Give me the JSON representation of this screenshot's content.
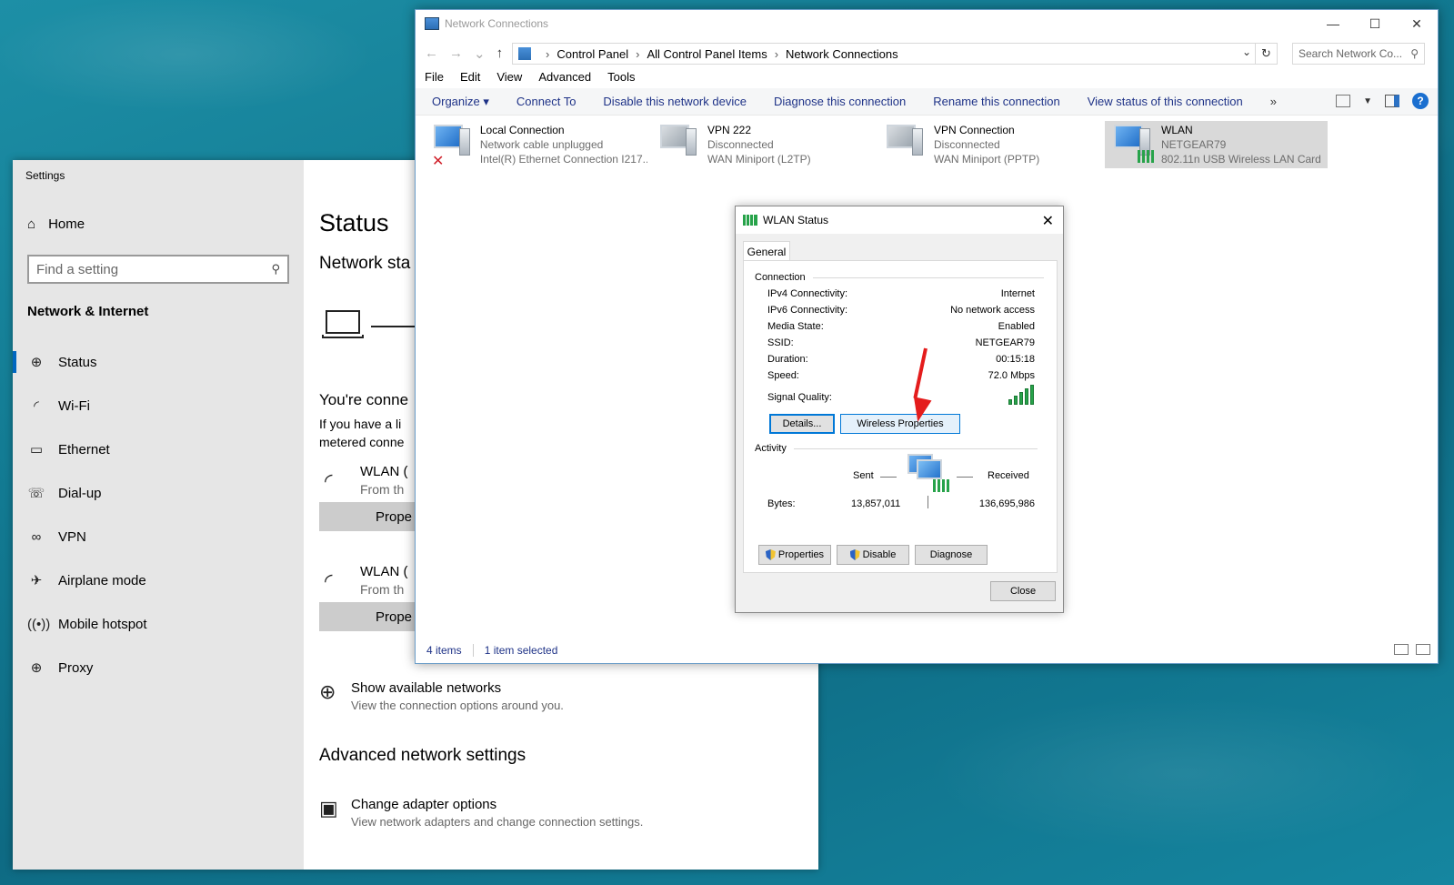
{
  "settings": {
    "window_title": "Settings",
    "home": "Home",
    "search_placeholder": "Find a setting",
    "section": "Network & Internet",
    "nav": [
      {
        "label": "Status",
        "icon": "globe-icon"
      },
      {
        "label": "Wi-Fi",
        "icon": "wifi-icon"
      },
      {
        "label": "Ethernet",
        "icon": "ethernet-icon"
      },
      {
        "label": "Dial-up",
        "icon": "dialup-icon"
      },
      {
        "label": "VPN",
        "icon": "vpn-icon"
      },
      {
        "label": "Airplane mode",
        "icon": "airplane-icon"
      },
      {
        "label": "Mobile hotspot",
        "icon": "hotspot-icon"
      },
      {
        "label": "Proxy",
        "icon": "proxy-icon"
      }
    ],
    "main": {
      "title": "Status",
      "subtitle": "Network sta",
      "connected": "You're conne",
      "para_line1": "If you have a li",
      "para_line2": "metered conne",
      "wlan1_name": "WLAN (",
      "wlan1_sub": "From th",
      "prop1": "Prope",
      "wlan2_name": "WLAN (",
      "wlan2_sub": "From th",
      "prop2": "Prope",
      "show_networks": "Show available networks",
      "show_networks_sub": "View the connection options around you.",
      "advanced": "Advanced network settings",
      "change_adapter": "Change adapter options",
      "change_adapter_sub": "View network adapters and change connection settings."
    }
  },
  "explorer": {
    "title": "Network Connections",
    "breadcrumb": [
      "Control Panel",
      "All Control Panel Items",
      "Network Connections"
    ],
    "search_placeholder": "Search Network Co...",
    "menu": [
      "File",
      "Edit",
      "View",
      "Advanced",
      "Tools"
    ],
    "commands": [
      "Organize ▾",
      "Connect To",
      "Disable this network device",
      "Diagnose this connection",
      "Rename this connection",
      "View status of this connection"
    ],
    "more": "»",
    "items": [
      {
        "name": "Local Connection",
        "status": "Network cable unplugged",
        "device": "Intel(R) Ethernet Connection I217..."
      },
      {
        "name": "VPN 222",
        "status": "Disconnected",
        "device": "WAN Miniport (L2TP)"
      },
      {
        "name": "VPN Connection",
        "status": "Disconnected",
        "device": "WAN Miniport (PPTP)"
      },
      {
        "name": "WLAN",
        "status": "NETGEAR79",
        "device": "802.11n USB Wireless LAN Card"
      }
    ],
    "status_items": "4 items",
    "status_selected": "1 item selected"
  },
  "dialog": {
    "title": "WLAN Status",
    "tab": "General",
    "connection_label": "Connection",
    "rows": [
      {
        "k": "IPv4 Connectivity:",
        "v": "Internet"
      },
      {
        "k": "IPv6 Connectivity:",
        "v": "No network access"
      },
      {
        "k": "Media State:",
        "v": "Enabled"
      },
      {
        "k": "SSID:",
        "v": "NETGEAR79"
      },
      {
        "k": "Duration:",
        "v": "00:15:18"
      },
      {
        "k": "Speed:",
        "v": "72.0 Mbps"
      }
    ],
    "signal_label": "Signal Quality:",
    "details_btn": "Details...",
    "wireless_btn": "Wireless Properties",
    "activity_label": "Activity",
    "sent": "Sent",
    "received": "Received",
    "bytes_label": "Bytes:",
    "bytes_sent": "13,857,011",
    "bytes_received": "136,695,986",
    "properties_btn": "Properties",
    "disable_btn": "Disable",
    "diagnose_btn": "Diagnose",
    "close_btn": "Close"
  },
  "colors": {
    "accent": "#0067c0",
    "annotation": "#e41c1c",
    "signal": "#27a34a"
  }
}
